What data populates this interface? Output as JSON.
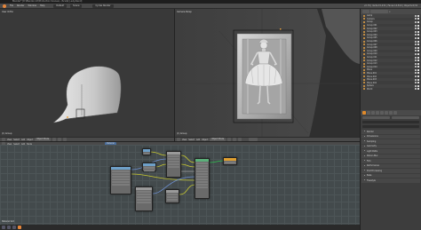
{
  "window": {
    "title": "Blender* [D:\\Blender Art\\Production Scenes\\...\\Sculpt_Lady.blend]"
  },
  "menubar": {
    "items": [
      "File",
      "Render",
      "Window",
      "Help"
    ],
    "layout": "Default",
    "scene": "Scene",
    "engine": "Cycles Render",
    "stats": "v2.79 | Verts:15,232 | Faces:14,810 | Objects:0/34"
  },
  "left_view": {
    "label": "User Ortho",
    "footer_label": "(1) Group",
    "header": [
      "View",
      "Select",
      "Add",
      "Object"
    ],
    "mode": "Object Mode"
  },
  "right_view": {
    "label": "Camera Persp",
    "footer_label": "(1) Group",
    "header": [
      "View",
      "Select",
      "Add",
      "Object"
    ],
    "mode": "Object Mode"
  },
  "outliner": {
    "items": [
      "Lamp",
      "Camera",
      "Group",
      "Group.001",
      "Group.002",
      "Group.003",
      "Group.004",
      "Group.005",
      "Group.006",
      "Group.007",
      "Group.008",
      "Group.009",
      "Group.010",
      "Group.011",
      "Group.012",
      "Group.013",
      "Group.014",
      "Plane",
      "Plane.001",
      "Plane.002",
      "Plane.003",
      "Plane.004",
      "Sphere",
      "World"
    ]
  },
  "properties": {
    "sections": [
      "Render",
      "Dimensions",
      "Sampling",
      "Geometry",
      "Light Paths",
      "Motion Blur",
      "Film",
      "Performance",
      "Post Processing",
      "Bake",
      "Freestyle"
    ]
  },
  "node_editor": {
    "header": [
      "View",
      "Select",
      "Add",
      "Node"
    ],
    "material": "Material",
    "label": "Material Slot"
  },
  "colors": {
    "accent": "#e08a2a",
    "node_blue": "#6ea0c8",
    "node_output": "#e0a030"
  }
}
